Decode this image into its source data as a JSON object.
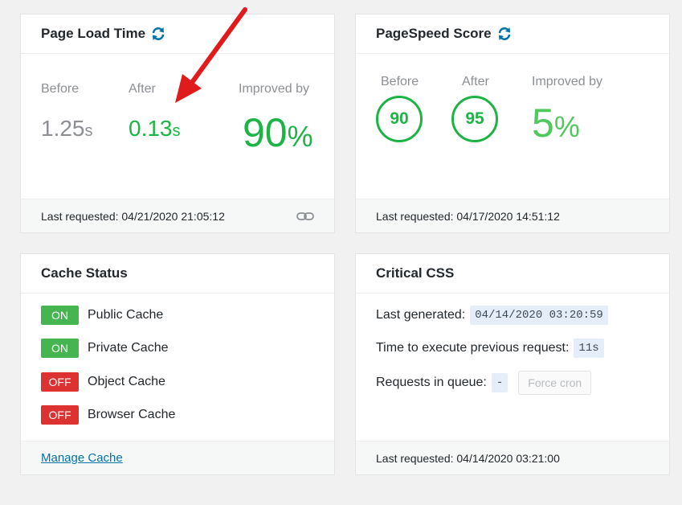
{
  "page_load_time": {
    "title": "Page Load Time",
    "before_label": "Before",
    "after_label": "After",
    "improved_label": "Improved by",
    "before_value": "1.25",
    "before_unit": "s",
    "after_value": "0.13",
    "after_unit": "s",
    "improved_value": "90",
    "improved_unit": "%",
    "last_requested": "Last requested: 04/21/2020 21:05:12"
  },
  "pagespeed": {
    "title": "PageSpeed Score",
    "before_label": "Before",
    "after_label": "After",
    "improved_label": "Improved by",
    "before_score": "90",
    "after_score": "95",
    "improved_value": "5",
    "improved_unit": "%",
    "last_requested": "Last requested: 04/17/2020 14:51:12"
  },
  "cache_status": {
    "title": "Cache Status",
    "items": [
      {
        "state": "ON",
        "label": "Public Cache"
      },
      {
        "state": "ON",
        "label": "Private Cache"
      },
      {
        "state": "OFF",
        "label": "Object Cache"
      },
      {
        "state": "OFF",
        "label": "Browser Cache"
      }
    ],
    "manage_link": "Manage Cache"
  },
  "critical_css": {
    "title": "Critical CSS",
    "last_generated_label": "Last generated:",
    "last_generated_value": "04/14/2020 03:20:59",
    "exec_time_label": "Time to execute previous request:",
    "exec_time_value": "11s",
    "queue_label": "Requests in queue:",
    "queue_value": "-",
    "force_cron": "Force cron",
    "last_requested": "Last requested: 04/14/2020 03:21:00"
  },
  "colors": {
    "green": "#1db446",
    "red_badge": "#dc3232",
    "green_badge": "#46b450",
    "link": "#0073aa",
    "refresh_icon": "#0073aa",
    "annotation_arrow": "#e01b1b"
  }
}
